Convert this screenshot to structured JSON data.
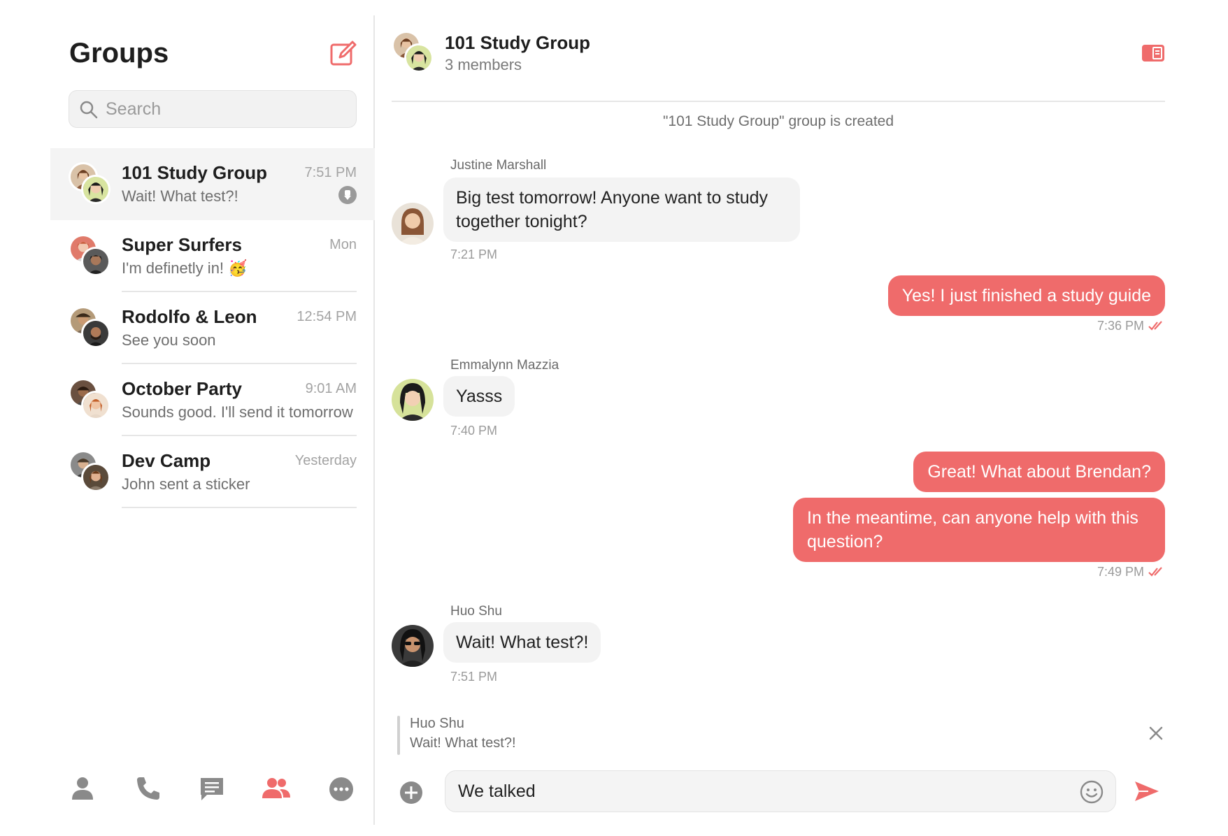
{
  "sidebar": {
    "title": "Groups",
    "search_placeholder": "Search",
    "conversations": [
      {
        "name": "101 Study Group",
        "preview": "Wait! What test?!",
        "time": "7:51 PM",
        "active": true
      },
      {
        "name": "Super Surfers",
        "preview": "I'm definetly in! 🥳",
        "time": "Mon"
      },
      {
        "name": "Rodolfo & Leon",
        "preview": "See you soon",
        "time": "12:54 PM"
      },
      {
        "name": "October Party",
        "preview": "Sounds good. I'll send it tomorrow",
        "time": "9:01 AM"
      },
      {
        "name": "Dev Camp",
        "preview": "John sent a sticker",
        "time": "Yesterday"
      }
    ],
    "nav": [
      "person-icon",
      "phone-icon",
      "chat-icon",
      "groups-icon",
      "more-icon"
    ],
    "active_nav": "groups-icon"
  },
  "chat": {
    "title": "101 Study Group",
    "members": "3 members",
    "system_message": "\"101 Study Group\" group is created",
    "messages": [
      {
        "sender": "Justine Marshall",
        "text": "Big test tomorrow! Anyone want to study together tonight?",
        "time": "7:21 PM"
      },
      {
        "text": "Yes! I just finished a study guide",
        "time": "7:36 PM"
      },
      {
        "sender": "Emmalynn Mazzia",
        "text": "Yasss",
        "time": "7:40 PM"
      },
      {
        "text": "Great! What about Brendan?"
      },
      {
        "text": "In the meantime, can anyone help with this question?",
        "time": "7:49 PM"
      },
      {
        "sender": "Huo Shu",
        "text": "Wait! What test?!",
        "time": "7:51 PM"
      }
    ],
    "reply": {
      "name": "Huo Shu",
      "text": "Wait! What test?!"
    },
    "composer_value": "We talked"
  },
  "colors": {
    "accent": "#ef6b6b",
    "muted": "#9a9a9a"
  }
}
